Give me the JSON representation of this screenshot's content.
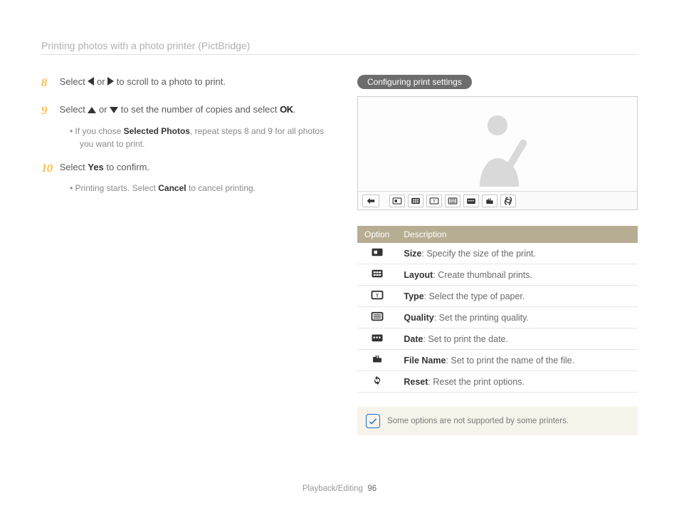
{
  "header": {
    "title": "Printing photos with a photo printer (PictBridge)"
  },
  "steps": {
    "s8": {
      "num": "8",
      "pre": "Select ",
      "mid": " or ",
      "post": " to scroll to a photo to print."
    },
    "s9": {
      "num": "9",
      "pre": "Select ",
      "mid": " or ",
      "post": " to set the number of copies and select ",
      "ok": "OK",
      "dot": ".",
      "sub_pre": "If you chose ",
      "sub_b": "Selected Photos",
      "sub_post": ", repeat steps 8 and 9 for all photos you want to print."
    },
    "s10": {
      "num": "10",
      "pre": "Select ",
      "b": "Yes",
      "post": " to confirm.",
      "sub_pre": "Printing starts. Select ",
      "sub_b": "Cancel",
      "sub_post": " to cancel printing."
    }
  },
  "pill": "Configuring print settings",
  "table": {
    "h1": "Option",
    "h2": "Description",
    "rows": [
      {
        "b": "Size",
        "rest": ": Specify the size of the print."
      },
      {
        "b": "Layout",
        "rest": ": Create thumbnail prints."
      },
      {
        "b": "Type",
        "rest": ": Select the type of paper."
      },
      {
        "b": "Quality",
        "rest": ": Set the printing quality."
      },
      {
        "b": "Date",
        "rest": ": Set to print the date."
      },
      {
        "b": "File Name",
        "rest": ": Set to print the name of the file."
      },
      {
        "b": "Reset",
        "rest": ": Reset the print options."
      }
    ]
  },
  "note": "Some options are not supported by some printers.",
  "footer": {
    "section": "Playback/Editing",
    "page": "96"
  }
}
